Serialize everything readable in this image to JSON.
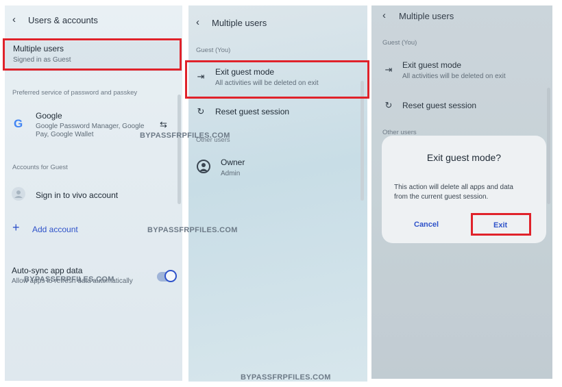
{
  "panel1": {
    "header": {
      "back_icon": "chevron-left-icon",
      "title": "Users & accounts"
    },
    "multiple_users": {
      "title": "Multiple users",
      "subtitle": "Signed in as Guest"
    },
    "password_section": "Preferred service of password and passkey",
    "google": {
      "icon": "google-logo-icon",
      "title": "Google",
      "subtitle_line1": "Google Password Manager, Google",
      "subtitle_line2": "Pay, Google Wallet",
      "swap_icon": "swap-arrows-icon"
    },
    "accounts_section": "Accounts for Guest",
    "sign_in": {
      "icon": "account-icon",
      "label": "Sign in to vivo account"
    },
    "add_account": {
      "icon": "plus-icon",
      "label": "Add account"
    },
    "auto_sync": {
      "title": "Auto-sync app data",
      "subtitle": "Allow apps to refresh data automatically",
      "enabled": true
    }
  },
  "panel2": {
    "header": {
      "back_icon": "chevron-left-icon",
      "title": "Multiple users"
    },
    "guest_section": "Guest (You)",
    "exit_guest": {
      "icon": "exit-icon",
      "title": "Exit guest mode",
      "subtitle": "All activities will be deleted on exit"
    },
    "reset_guest": {
      "icon": "reset-icon",
      "title": "Reset guest session"
    },
    "other_users_section": "Other users",
    "owner": {
      "icon": "account-circle-icon",
      "title": "Owner",
      "subtitle": "Admin"
    }
  },
  "panel3": {
    "header": {
      "back_icon": "chevron-left-icon",
      "title": "Multiple users"
    },
    "guest_section": "Guest (You)",
    "exit_guest": {
      "icon": "exit-icon",
      "title": "Exit guest mode",
      "subtitle": "All activities will be deleted on exit"
    },
    "reset_guest": {
      "icon": "reset-icon",
      "title": "Reset guest session"
    },
    "other_users_section": "Other users",
    "dialog": {
      "title": "Exit guest mode?",
      "message_line1": "This action will delete all apps and data",
      "message_line2": "from the current guest session.",
      "cancel_label": "Cancel",
      "exit_label": "Exit"
    }
  },
  "watermarks": [
    "BYPASSFRPFILES.COM",
    "BYPASSFRPFILES.COM",
    "BYPASSFRPFILES.COM",
    "BYPASSFRPFILES.COM"
  ],
  "colors": {
    "highlight": "#e0222a",
    "accent_blue": "#2e52c9",
    "dialog_bg": "#eef1f3"
  }
}
